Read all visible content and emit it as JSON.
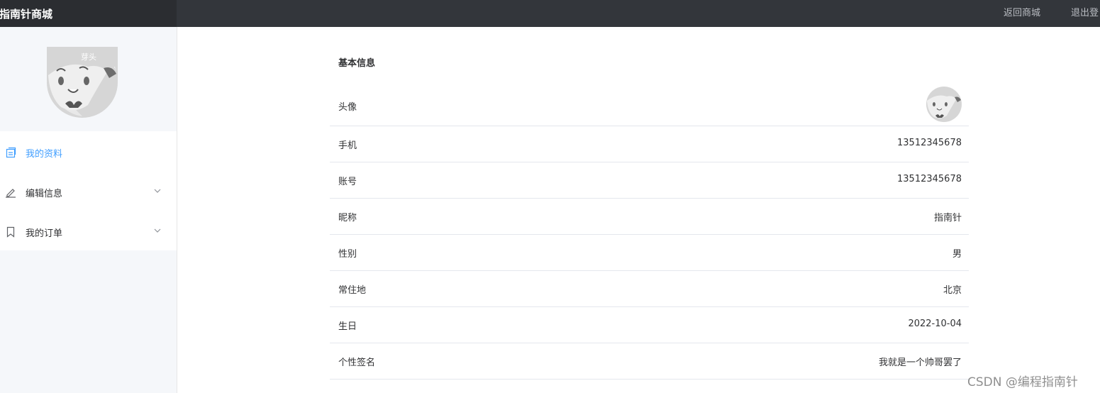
{
  "header": {
    "brand": "指南针商城",
    "back_link": "返回商城",
    "logout_link": "退出登"
  },
  "sidebar": {
    "menu": [
      {
        "label": "我的资料",
        "icon": "document-icon",
        "active": true
      },
      {
        "label": "编辑信息",
        "icon": "edit-pen-icon",
        "active": false
      },
      {
        "label": "我的订单",
        "icon": "bookmark-icon",
        "active": false
      }
    ]
  },
  "profile": {
    "section_title": "基本信息",
    "rows": [
      {
        "label": "头像",
        "value": ""
      },
      {
        "label": "手机",
        "value": "13512345678"
      },
      {
        "label": "账号",
        "value": "13512345678"
      },
      {
        "label": "昵称",
        "value": "指南针"
      },
      {
        "label": "性别",
        "value": "男"
      },
      {
        "label": "常住地",
        "value": "北京"
      },
      {
        "label": "生日",
        "value": "2022-10-04"
      },
      {
        "label": "个性签名",
        "value": "我就是一个帅哥罢了"
      }
    ]
  },
  "watermark": "CSDN @编程指南针",
  "colors": {
    "topbar": "#33363b",
    "brand_bg": "#2b2d31",
    "accent": "#409eff",
    "sidebar_bg": "#f5f7fa"
  }
}
